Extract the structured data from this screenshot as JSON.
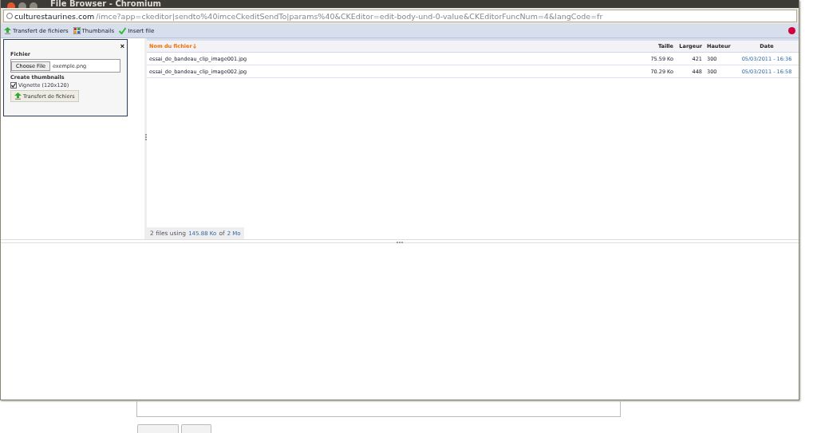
{
  "window": {
    "title": "File Browser - Chromium"
  },
  "address": {
    "host": "culturestaurines.com",
    "path": "/imce?app=ckeditor|sendto%40imceCkeditSendTo|params%40&CKEditor=edit-body-und-0-value&CKEditorFuncNum=4&langCode=fr"
  },
  "toolbar": [
    {
      "label": "Transfert de fichiers",
      "kind": "upload"
    },
    {
      "label": "Thumbnails",
      "kind": "thumbs"
    },
    {
      "label": "Insert file",
      "kind": "insert"
    }
  ],
  "upload_panel": {
    "close": "×",
    "file_label": "Fichier",
    "choose_button": "Choose File",
    "file_name": "exemple.png",
    "thumbs_label": "Create thumbnails",
    "options": [
      {
        "label": "Vignette (120x120)",
        "checked": true
      }
    ],
    "submit": "Transfert de fichiers"
  },
  "table": {
    "columns": [
      {
        "label": "Nom du fichier",
        "sorted": true
      },
      {
        "label": "Taille",
        "sorted": false
      },
      {
        "label": "Largeur",
        "sorted": false
      },
      {
        "label": "Hauteur",
        "sorted": false
      },
      {
        "label": "Date",
        "sorted": false
      }
    ],
    "rows": [
      [
        "essai_de_bandeau_clip_image001.jpg",
        "75.59 Ko",
        "421",
        "300",
        "05/03/2011 - 16:36"
      ],
      [
        "essai_de_bandeau_clip_image002.jpg",
        "70.29 Ko",
        "448",
        "300",
        "05/03/2011 - 16:58"
      ]
    ]
  },
  "status": {
    "prefix": "2 files using",
    "used": "145.88 Ko",
    "mid": "of",
    "quota": "2 Mo"
  }
}
